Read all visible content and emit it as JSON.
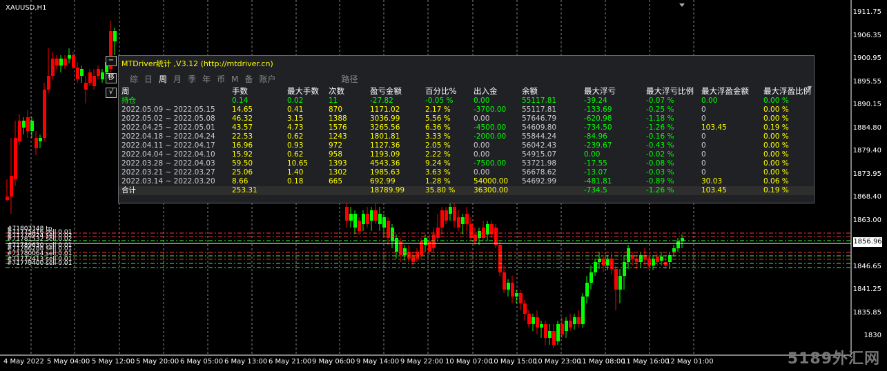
{
  "chart": {
    "symbol": "XAUUSD,H1",
    "current_price": "1856.96",
    "price_labels": [
      "1911.75",
      "1906.35",
      "1900.95",
      "1895.55",
      "1890.15",
      "1884.80",
      "1879.40",
      "1873.95",
      "1868.40",
      "1863.00",
      "1852.75",
      "1846.65",
      "1841.25",
      "1835.85",
      "1830"
    ],
    "time_labels": [
      "4 May 2022",
      "5 May 04:00",
      "5 May 12:00",
      "5 May 20:00",
      "6 May 05:00",
      "6 May 13:00",
      "6 May 21:00",
      "9 May 06:00",
      "9 May 14:00",
      "9 May 22:00",
      "10 May 07:00",
      "10 May 15:00",
      "10 May 23:00",
      "11 May 08:00",
      "11 May 16:00",
      "12 May 01:00"
    ],
    "order_labels": [
      "#71803348 tp",
      "#71775416 sell 0.01",
      "#71778924 sell 0.02",
      "#71781532 sell 0.02",
      "#71789630 sell 0.01",
      "#71786288 sell 0.01",
      "#71780064 sell 0.01",
      "#71772413 sell 0.01",
      "#71779400 sell 0.01"
    ],
    "minus_btn": "−",
    "move_btn": "移",
    "check_btn": "√",
    "watermark": "5189外汇网",
    "colors": {
      "bull": "#00ff00",
      "bear": "#ff0000",
      "grid": "#ffffff"
    }
  },
  "panel": {
    "title": "MTDriver统计 ,V3.12 (http://mtdriver.cn)",
    "tabs": [
      "综",
      "日",
      "周",
      "月",
      "季",
      "年",
      "币",
      "M",
      "备",
      "账户"
    ],
    "active_tab": "周",
    "route_tab": "路径",
    "headers": [
      "周",
      "手数",
      "最大手数",
      "次数",
      "盈亏金额",
      "百分比%",
      "出入金",
      "余额",
      "最大浮亏",
      "最大浮亏比例",
      "最大浮盈金额",
      "最大浮盈比例"
    ],
    "position_row": [
      "持仓",
      "0.14",
      "0.02",
      "11",
      "-27.82",
      "-0.05 %",
      "0.00",
      "55117.81",
      "-39.24",
      "-0.07 %",
      "0.00",
      "0.00 %"
    ],
    "rows": [
      [
        "2022.05.09 ~ 2022.05.15",
        "14.65",
        "0.41",
        "870",
        "1171.02",
        "2.17 %",
        "-3700.00",
        "55117.81",
        "-133.69",
        "-0.25 %",
        "0",
        "0.00 %"
      ],
      [
        "2022.05.02 ~ 2022.05.08",
        "46.32",
        "3.15",
        "1388",
        "3036.99",
        "5.56 %",
        "0.00",
        "57646.79",
        "-620.98",
        "-1.18 %",
        "0",
        "0.00 %"
      ],
      [
        "2022.04.25 ~ 2022.05.01",
        "43.57",
        "4.73",
        "1576",
        "3265.56",
        "6.36 %",
        "-4500.00",
        "54609.80",
        "-734.50",
        "-1.26 %",
        "103.45",
        "0.19 %"
      ],
      [
        "2022.04.18 ~ 2022.04.24",
        "22.53",
        "0.62",
        "1243",
        "1801.81",
        "3.33 %",
        "-2000.00",
        "55844.24",
        "-84.96",
        "-0.16 %",
        "0",
        "0.00 %"
      ],
      [
        "2022.04.11 ~ 2022.04.17",
        "16.96",
        "0.93",
        "972",
        "1127.36",
        "2.05 %",
        "0.00",
        "56042.43",
        "-239.67",
        "-0.43 %",
        "0",
        "0.00 %"
      ],
      [
        "2022.04.04 ~ 2022.04.10",
        "15.92",
        "0.62",
        "958",
        "1193.09",
        "2.22 %",
        "0.00",
        "54915.07",
        "0.00",
        "-0.02 %",
        "0",
        "0.00 %"
      ],
      [
        "2022.03.28 ~ 2022.04.03",
        "59.50",
        "10.65",
        "1393",
        "4543.36",
        "9.24 %",
        "-7500.00",
        "53721.98",
        "-17.55",
        "-0.08 %",
        "0",
        "0.00 %"
      ],
      [
        "2022.03.21 ~ 2022.03.27",
        "25.06",
        "1.40",
        "1302",
        "1985.63",
        "3.63 %",
        "0.00",
        "56678.62",
        "-13.07",
        "-0.03 %",
        "0",
        "0.00 %"
      ],
      [
        "2022.03.14 ~ 2022.03.20",
        "8.66",
        "0.18",
        "665",
        "692.99",
        "1.28 %",
        "54000.00",
        "54692.99",
        "-481.81",
        "-0.89 %",
        "30.03",
        "0.06 %"
      ]
    ],
    "total_row": [
      "合计",
      "253.31",
      "",
      "",
      "18789.99",
      "35.80 %",
      "36300.00",
      "",
      "-734.5",
      "-1.26 %",
      "103.45",
      "0.19 %"
    ]
  }
}
